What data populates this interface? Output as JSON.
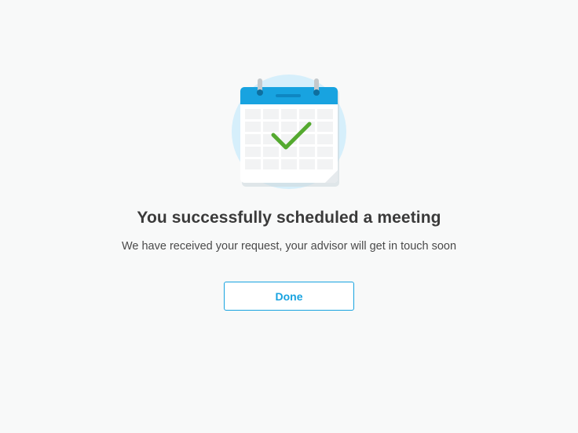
{
  "confirmation": {
    "title": "You successfully scheduled a meeting",
    "message": "We have received your request, your advisor will get in touch soon",
    "done_label": "Done"
  },
  "illustration": {
    "icon": "calendar-check-icon",
    "colors": {
      "halo": "#d6effb",
      "calendar_header": "#18a3e0",
      "check": "#54a92f",
      "grid_cell": "#f2f3f4"
    }
  },
  "colors": {
    "background": "#f8f9f9",
    "accent": "#18a3e0",
    "title_text": "#3a3a3a",
    "body_text": "#4a4a4a"
  }
}
